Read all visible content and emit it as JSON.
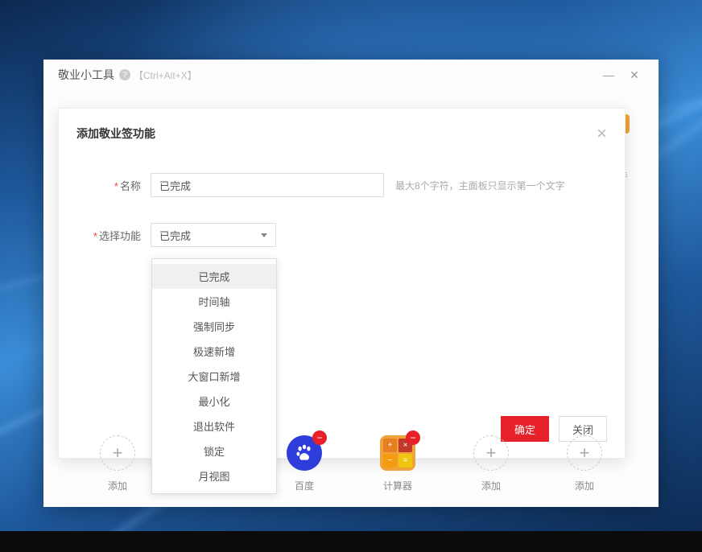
{
  "app": {
    "title": "敬业小工具",
    "shortcut": "【Ctrl+Alt+X】"
  },
  "modal": {
    "title": "添加敬业签功能",
    "nameLabel": "名称",
    "nameValue": "已完成",
    "nameHint": "最大8个字符，主面板只显示第一个文字",
    "selectLabel": "选择功能",
    "selectValue": "已完成",
    "options": [
      "已完成",
      "时间轴",
      "强制同步",
      "极速新增",
      "大窗口新增",
      "最小化",
      "退出软件",
      "锁定",
      "月视图"
    ],
    "confirmLabel": "确定",
    "cancelLabel": "关闭"
  },
  "tools": {
    "addLabel": "添加",
    "baiduLabel": "百度",
    "calcLabel": "计算器"
  }
}
